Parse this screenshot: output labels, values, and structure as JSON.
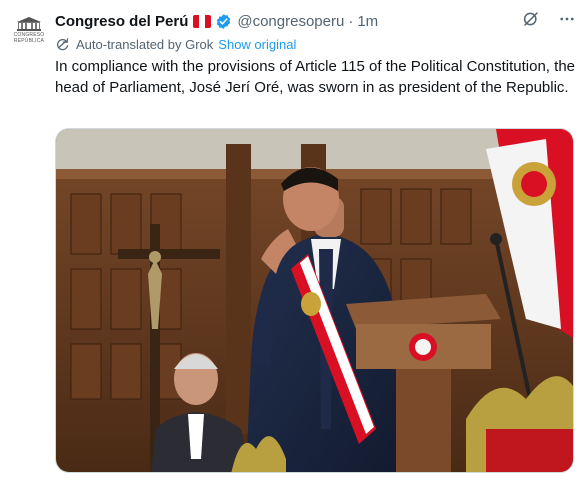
{
  "post": {
    "author_name": "Congreso del Perú",
    "author_handle": "@congresoperu",
    "separator": "·",
    "timestamp": "1m",
    "avatar_caption_line1": "CONGRESO",
    "avatar_caption_line2": "REPÚBLICA",
    "translation_note": "Auto-translated by Grok",
    "show_original_label": "Show original",
    "body_text": "In compliance with the provisions of Article 115 of the Political Constitution, the head of Parliament, José Jerí Oré, was sworn in as president of the Republic.",
    "icons": {
      "verified": "verified-badge-icon",
      "grok": "grok-icon",
      "more": "more-options-icon",
      "translate": "translate-icon",
      "flag": "peru-flag-icon"
    },
    "colors": {
      "accent": "#1d9bf0",
      "secondary_text": "#536471",
      "primary_text": "#0f1419",
      "flag_red": "#d91023"
    }
  }
}
